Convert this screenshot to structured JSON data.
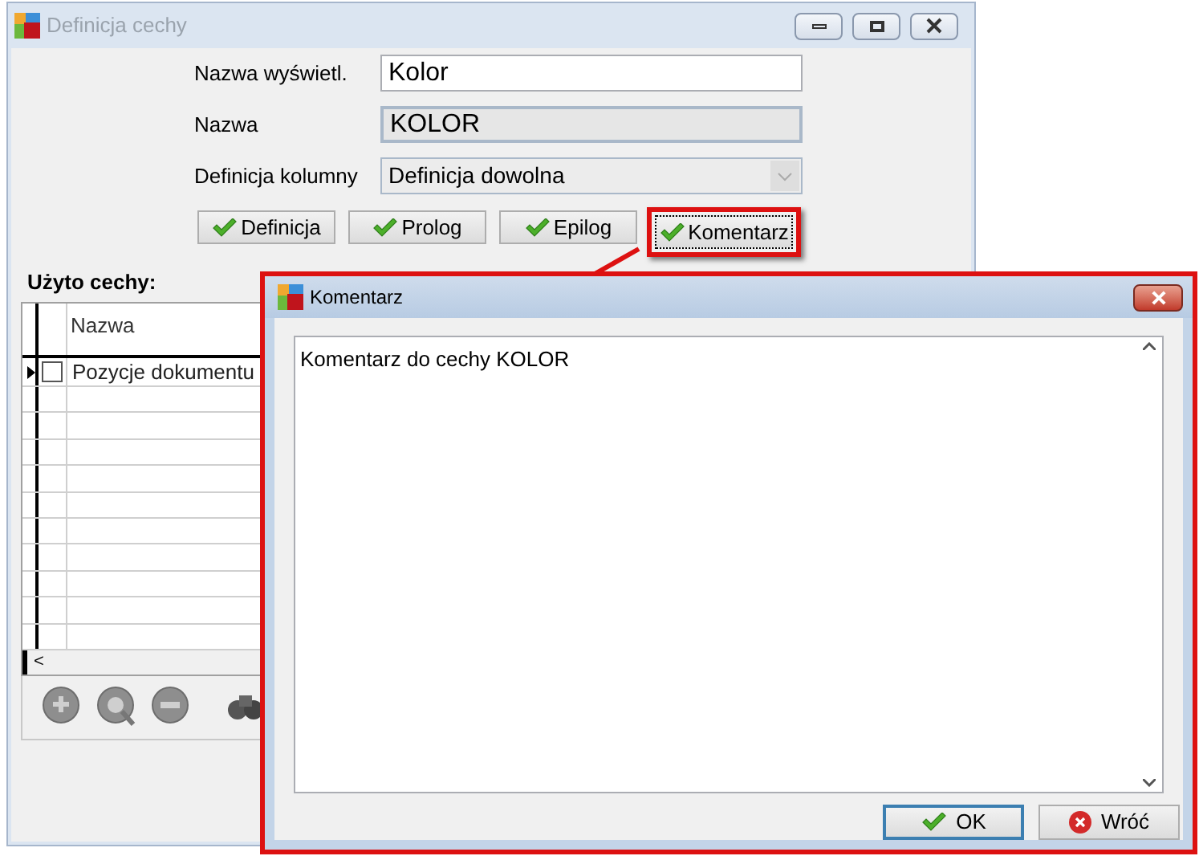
{
  "main_window": {
    "title": "Definicja cechy"
  },
  "fields": [
    {
      "kind": "text",
      "label": "Nazwa wyświetl.",
      "value": "Kolor",
      "disabled": false
    },
    {
      "kind": "text",
      "label": "Nazwa",
      "value": "KOLOR",
      "disabled": true
    },
    {
      "kind": "select",
      "label": "Definicja kolumny",
      "value": "Definicja dowolna",
      "disabled": true
    }
  ],
  "buttons": [
    {
      "label": "Definicja",
      "highlighted": false
    },
    {
      "label": "Prolog",
      "highlighted": false
    },
    {
      "label": "Epilog",
      "highlighted": false
    },
    {
      "label": "Komentarz",
      "highlighted": true
    }
  ],
  "used_section": {
    "title": "Użyto cechy:",
    "columns": [
      "Nazwa"
    ],
    "scroll_arrow": "<",
    "rows": [
      {
        "name": "Pozycje dokumentu",
        "checked": false,
        "selected": true
      }
    ]
  },
  "dialog": {
    "title": "Komentarz",
    "text": "Komentarz do cechy KOLOR",
    "buttons": [
      {
        "kind": "ok",
        "label": "OK"
      },
      {
        "kind": "cancel",
        "label": "Wróć"
      }
    ]
  }
}
